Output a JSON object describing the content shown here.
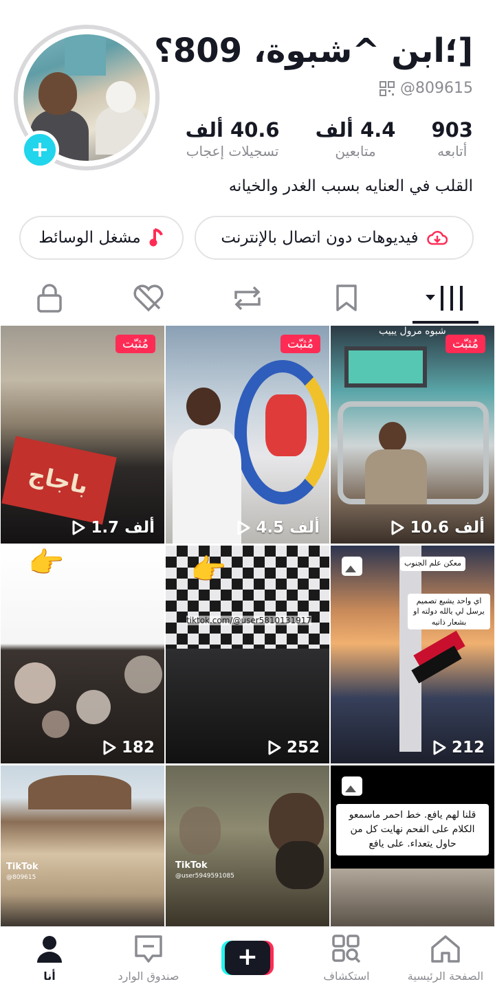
{
  "profile": {
    "display_name": "[؛ابن ^شبوة، 809؟",
    "handle": "@809615",
    "stats": [
      {
        "value": "903",
        "label": "أتابعه"
      },
      {
        "value": "4.4 ألف",
        "label": "متابعين"
      },
      {
        "value": "40.6 ألف",
        "label": "تسجيلات إعجاب"
      }
    ],
    "bio": "القلب في العنايه بسبب الغدر والخيانه",
    "offline_button": "فيديوهات دون اتصال بالإنترنت",
    "player_button": "مشغل الوسائط"
  },
  "tabs": [
    {
      "name": "videos",
      "icon": "grid-icon"
    },
    {
      "name": "favorites",
      "icon": "bookmark-icon"
    },
    {
      "name": "reposts",
      "icon": "repost-icon"
    },
    {
      "name": "liked",
      "icon": "heart-hidden-icon"
    },
    {
      "name": "private",
      "icon": "lock-icon"
    }
  ],
  "grid": {
    "pinned_label": "مُثبّت",
    "items": [
      {
        "views": "10.6 ألف",
        "pinned": true,
        "caption": "شبوه مرول يبيب"
      },
      {
        "views": "4.5 ألف",
        "pinned": true
      },
      {
        "views": "1.7 ألف",
        "pinned": true,
        "caption": "باجاج"
      },
      {
        "views": "212",
        "pinned": false,
        "photo": true,
        "overlay": "اي واحد يشيع تصميم يرسل لي يالله دولته او بشعار ذاتيه",
        "badge": "معكن علم الجنوب"
      },
      {
        "views": "252",
        "pinned": false,
        "overlay": "tiktok.com/@user5810131917"
      },
      {
        "views": "182",
        "pinned": false
      },
      {
        "views": "",
        "pinned": false,
        "photo": true,
        "overlay": "قلنا لهم يافع. خط احمر ماسمعو الكلام على الفحم نهايت كل من حاول يتعداء. على يافع"
      },
      {
        "views": "",
        "pinned": false,
        "watermark": "TikTok",
        "watermark_user": "@user5949591085"
      },
      {
        "views": "",
        "pinned": false,
        "watermark": "TikTok",
        "watermark_user": "@809615"
      }
    ]
  },
  "nav": [
    {
      "label": "الصفحة الرئيسية",
      "icon": "home-icon"
    },
    {
      "label": "استكشاف",
      "icon": "discover-icon"
    },
    {
      "label": "",
      "icon": "create-icon"
    },
    {
      "label": "صندوق الوارد",
      "icon": "inbox-icon"
    },
    {
      "label": "أنا",
      "icon": "profile-icon",
      "active": true
    }
  ],
  "colors": {
    "accent": "#fe2c55",
    "cyan": "#25f4ee",
    "text": "#161823",
    "muted": "#8a8b91"
  }
}
